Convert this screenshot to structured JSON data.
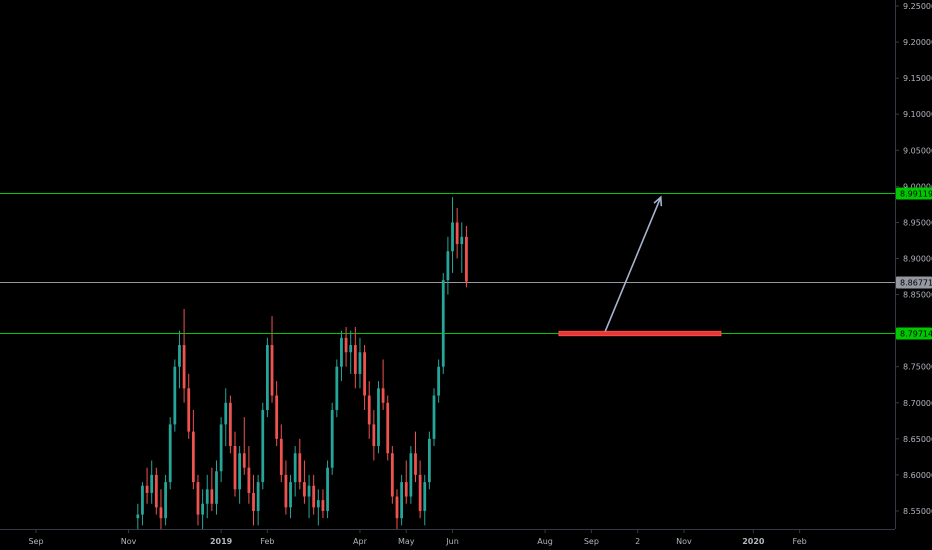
{
  "chart_data": {
    "type": "candlestick",
    "title": "",
    "ylim": [
      8.525,
      9.25
    ],
    "price_axis": {
      "tick_labels": [
        "9.25000",
        "9.20000",
        "9.15000",
        "9.10000",
        "9.05000",
        "9.00000",
        "8.95000",
        "8.90000",
        "8.85000",
        "8.80000",
        "8.75000",
        "8.70000",
        "8.65000",
        "8.60000",
        "8.55000"
      ],
      "tick_values": [
        9.25,
        9.2,
        9.15,
        9.1,
        9.05,
        9.0,
        8.95,
        8.9,
        8.85,
        8.8,
        8.75,
        8.7,
        8.65,
        8.6,
        8.55
      ]
    },
    "time_axis": {
      "labels": [
        "Sep",
        "Nov",
        "2019",
        "Feb",
        "Apr",
        "May",
        "Jun",
        "Aug",
        "Sep",
        "2",
        "Nov",
        "2020",
        "Feb"
      ],
      "label_index": [
        0,
        20,
        40,
        50,
        70,
        80,
        90,
        110,
        120,
        130,
        140,
        155,
        165
      ],
      "bold_labels": [
        "2019",
        "2020"
      ]
    },
    "horizontal_lines": [
      {
        "name": "resistance",
        "price": 8.99119,
        "label": "8.99119",
        "color": "#00c800"
      },
      {
        "name": "last-price",
        "price": 8.86771,
        "label": "8.86771",
        "color": "#9598a1"
      },
      {
        "name": "support",
        "price": 8.79714,
        "label": "8.79714",
        "color": "#00c800"
      }
    ],
    "zone": {
      "price_top": 8.799,
      "price_bottom": 8.793,
      "from_index": 113,
      "to_index": 148,
      "color": "#e53935"
    },
    "arrow": {
      "from_index": 123,
      "from_price": 8.799,
      "to_index": 135,
      "to_price": 8.985,
      "color": "#a6b4d0"
    },
    "candles": {
      "first_index": 22,
      "up_color": "#26a69a",
      "down_color": "#ef5350",
      "bars": [
        [
          8.54,
          8.56,
          8.525,
          8.545
        ],
        [
          8.545,
          8.59,
          8.53,
          8.585
        ],
        [
          8.585,
          8.61,
          8.56,
          8.575
        ],
        [
          8.575,
          8.62,
          8.56,
          8.6
        ],
        [
          8.6,
          8.61,
          8.545,
          8.555
        ],
        [
          8.555,
          8.58,
          8.525,
          8.54
        ],
        [
          8.54,
          8.6,
          8.53,
          8.59
        ],
        [
          8.59,
          8.68,
          8.58,
          8.67
        ],
        [
          8.67,
          8.76,
          8.66,
          8.75
        ],
        [
          8.75,
          8.8,
          8.72,
          8.78
        ],
        [
          8.78,
          8.83,
          8.7,
          8.72
        ],
        [
          8.72,
          8.74,
          8.65,
          8.66
        ],
        [
          8.66,
          8.69,
          8.58,
          8.59
        ],
        [
          8.59,
          8.6,
          8.53,
          8.545
        ],
        [
          8.545,
          8.58,
          8.525,
          8.56
        ],
        [
          8.56,
          8.6,
          8.54,
          8.58
        ],
        [
          8.58,
          8.61,
          8.55,
          8.56
        ],
        [
          8.56,
          8.62,
          8.545,
          8.605
        ],
        [
          8.605,
          8.68,
          8.59,
          8.67
        ],
        [
          8.67,
          8.72,
          8.64,
          8.7
        ],
        [
          8.7,
          8.71,
          8.63,
          8.64
        ],
        [
          8.64,
          8.66,
          8.57,
          8.58
        ],
        [
          8.58,
          8.64,
          8.56,
          8.63
        ],
        [
          8.63,
          8.68,
          8.6,
          8.61
        ],
        [
          8.61,
          8.64,
          8.56,
          8.575
        ],
        [
          8.575,
          8.6,
          8.53,
          8.55
        ],
        [
          8.55,
          8.6,
          8.53,
          8.59
        ],
        [
          8.59,
          8.7,
          8.58,
          8.69
        ],
        [
          8.69,
          8.79,
          8.68,
          8.78
        ],
        [
          8.78,
          8.82,
          8.7,
          8.71
        ],
        [
          8.71,
          8.73,
          8.64,
          8.65
        ],
        [
          8.65,
          8.67,
          8.59,
          8.6
        ],
        [
          8.6,
          8.62,
          8.545,
          8.555
        ],
        [
          8.555,
          8.6,
          8.54,
          8.59
        ],
        [
          8.59,
          8.64,
          8.57,
          8.63
        ],
        [
          8.63,
          8.65,
          8.58,
          8.59
        ],
        [
          8.59,
          8.62,
          8.56,
          8.57
        ],
        [
          8.57,
          8.6,
          8.54,
          8.585
        ],
        [
          8.585,
          8.6,
          8.545,
          8.555
        ],
        [
          8.555,
          8.58,
          8.53,
          8.565
        ],
        [
          8.565,
          8.58,
          8.54,
          8.55
        ],
        [
          8.55,
          8.62,
          8.54,
          8.61
        ],
        [
          8.61,
          8.7,
          8.6,
          8.69
        ],
        [
          8.69,
          8.76,
          8.68,
          8.75
        ],
        [
          8.75,
          8.8,
          8.73,
          8.79
        ],
        [
          8.79,
          8.805,
          8.75,
          8.77
        ],
        [
          8.77,
          8.8,
          8.74,
          8.78
        ],
        [
          8.78,
          8.805,
          8.72,
          8.74
        ],
        [
          8.74,
          8.79,
          8.72,
          8.77
        ],
        [
          8.77,
          8.78,
          8.69,
          8.71
        ],
        [
          8.71,
          8.73,
          8.65,
          8.67
        ],
        [
          8.67,
          8.69,
          8.62,
          8.64
        ],
        [
          8.64,
          8.73,
          8.63,
          8.72
        ],
        [
          8.72,
          8.76,
          8.69,
          8.7
        ],
        [
          8.7,
          8.71,
          8.62,
          8.63
        ],
        [
          8.63,
          8.64,
          8.56,
          8.57
        ],
        [
          8.57,
          8.58,
          8.525,
          8.54
        ],
        [
          8.54,
          8.6,
          8.53,
          8.59
        ],
        [
          8.59,
          8.62,
          8.56,
          8.57
        ],
        [
          8.57,
          8.64,
          8.56,
          8.63
        ],
        [
          8.63,
          8.66,
          8.59,
          8.6
        ],
        [
          8.6,
          8.62,
          8.54,
          8.55
        ],
        [
          8.55,
          8.6,
          8.53,
          8.59
        ],
        [
          8.59,
          8.66,
          8.58,
          8.65
        ],
        [
          8.65,
          8.72,
          8.64,
          8.71
        ],
        [
          8.71,
          8.76,
          8.7,
          8.75
        ],
        [
          8.75,
          8.88,
          8.74,
          8.87
        ],
        [
          8.87,
          8.93,
          8.85,
          8.91
        ],
        [
          8.91,
          8.985,
          8.88,
          8.95
        ],
        [
          8.95,
          8.97,
          8.9,
          8.92
        ],
        [
          8.92,
          8.95,
          8.88,
          8.93
        ],
        [
          8.93,
          8.945,
          8.86,
          8.868
        ]
      ]
    }
  }
}
